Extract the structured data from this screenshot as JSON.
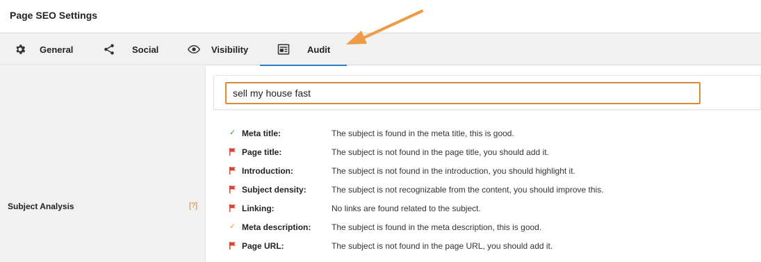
{
  "panel": {
    "title": "Page SEO Settings"
  },
  "tabs": [
    {
      "label": "General",
      "icon": "gear-icon"
    },
    {
      "label": "Social",
      "icon": "share-icon"
    },
    {
      "label": "Visibility",
      "icon": "eye-icon"
    },
    {
      "label": "Audit",
      "icon": "audit-card-icon",
      "active": true
    }
  ],
  "subject": {
    "label": "Subject Analysis",
    "help": "[?]",
    "value": "sell my house fast"
  },
  "results": [
    {
      "label": "Meta title:",
      "message": "The subject is found in the meta title, this is good.",
      "status": "good",
      "status_color": "#3aa13a"
    },
    {
      "label": "Page title:",
      "message": "The subject is not found in the page title, you should add it.",
      "status": "bad",
      "status_color": "#d14836"
    },
    {
      "label": "Introduction:",
      "message": "The subject is not found in the introduction, you should highlight it.",
      "status": "bad",
      "status_color": "#d14836"
    },
    {
      "label": "Subject density:",
      "message": "The subject is not recognizable from the content, you should improve this.",
      "status": "bad",
      "status_color": "#d14836"
    },
    {
      "label": "Linking:",
      "message": "No links are found related to the subject.",
      "status": "bad",
      "status_color": "#d14836"
    },
    {
      "label": "Meta description:",
      "message": "The subject is found in the meta description, this is good.",
      "status": "ok",
      "status_color": "#e89a3c"
    },
    {
      "label": "Page URL:",
      "message": "The subject is not found in the page URL, you should add it.",
      "status": "bad",
      "status_color": "#d14836"
    }
  ],
  "colors": {
    "accent": "#2d7ec4",
    "annotation_arrow": "#ef9a45",
    "input_border": "#d98a3a"
  }
}
